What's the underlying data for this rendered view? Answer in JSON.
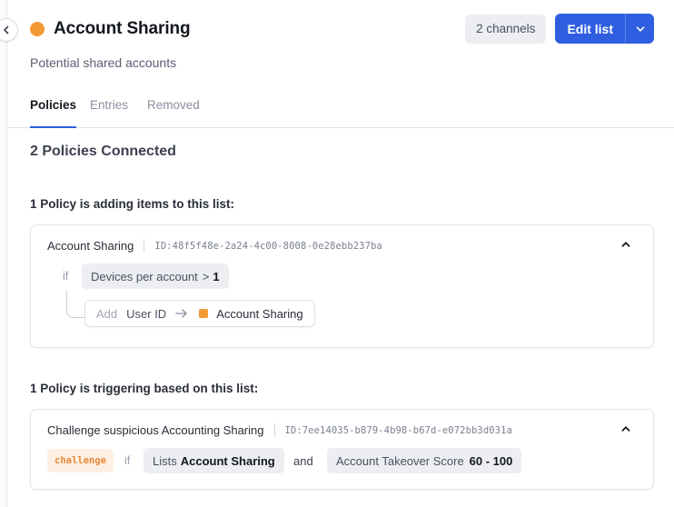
{
  "header": {
    "title": "Account Sharing",
    "subtitle": "Potential shared accounts",
    "channels_label": "2 channels",
    "edit_label": "Edit list",
    "status_color": "#f29a34",
    "accent_color": "#2f5fe0"
  },
  "tabs": [
    {
      "label": "Policies",
      "active": true
    },
    {
      "label": "Entries",
      "active": false
    },
    {
      "label": "Removed",
      "active": false
    }
  ],
  "policies": {
    "summary": "2 Policies Connected",
    "adding": {
      "heading": "1 Policy is adding items to this list:",
      "policy_name": "Account Sharing",
      "policy_id": "ID:48f5f48e-2a24-4c00-8008-0e28ebb237ba",
      "condition_keyword": "if",
      "condition_field": "Devices per account",
      "condition_operator": ">",
      "condition_value": "1",
      "action_keyword": "Add",
      "action_field": "User ID",
      "action_target": "Account Sharing"
    },
    "triggering": {
      "heading": "1 Policy is triggering based on this list:",
      "policy_name": "Challenge suspicious Accounting Sharing",
      "policy_id": "ID:7ee14035-b879-4b98-b67d-e072bb3d031a",
      "outcome_tag": "challenge",
      "condition_keyword": "if",
      "list_prefix": "Lists",
      "list_name": "Account Sharing",
      "joiner": "and",
      "score_label": "Account Takeover Score",
      "score_range": "60 - 100"
    }
  }
}
